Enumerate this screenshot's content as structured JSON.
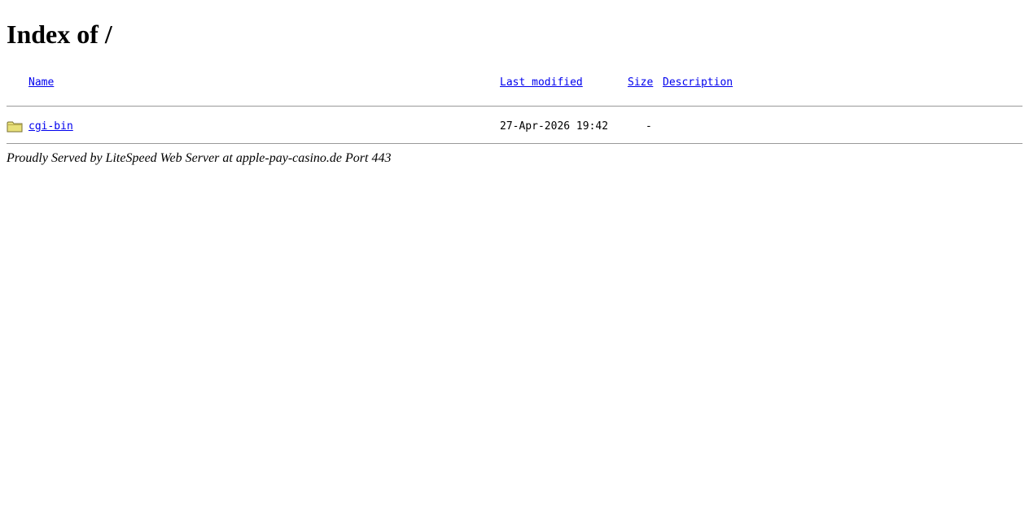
{
  "page": {
    "title": "Index of /"
  },
  "table": {
    "headers": {
      "name": "Name",
      "last_modified": "Last modified",
      "size": "Size",
      "description": "Description"
    },
    "rows": [
      {
        "icon": "folder-icon",
        "name": "cgi-bin",
        "last_modified": "27-Apr-2026 19:42",
        "size": "-",
        "description": ""
      }
    ]
  },
  "footer": {
    "signature": "Proudly Served by LiteSpeed Web Server at apple-pay-casino.de Port 443"
  },
  "colors": {
    "link": "#0000ee",
    "rule": "#9a9a9a",
    "folder": "#e8e07a"
  }
}
